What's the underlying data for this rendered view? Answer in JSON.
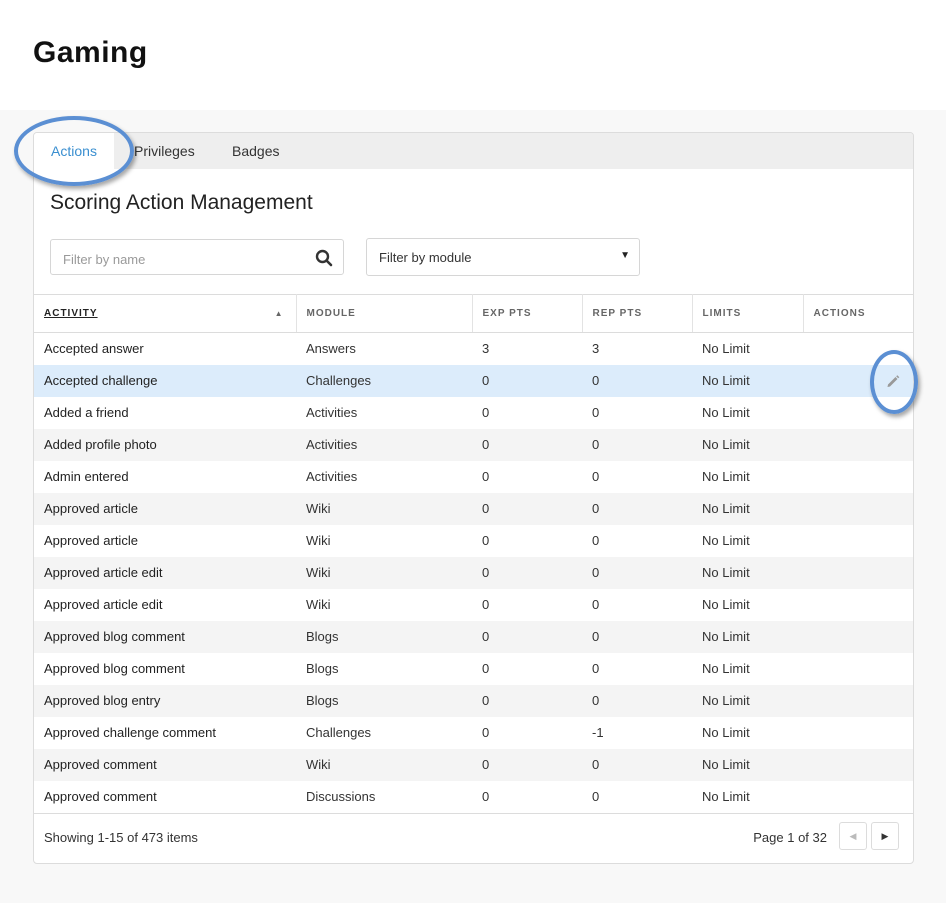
{
  "page": {
    "title": "Gaming"
  },
  "tabs": [
    {
      "label": "Actions",
      "active": true
    },
    {
      "label": "Privileges",
      "active": false
    },
    {
      "label": "Badges",
      "active": false
    }
  ],
  "section": {
    "title": "Scoring Action Management"
  },
  "filters": {
    "name_placeholder": "Filter by name",
    "name_value": "",
    "module_selected": "Filter by module"
  },
  "table": {
    "columns": [
      "ACTIVITY",
      "MODULE",
      "EXP PTS",
      "REP PTS",
      "LIMITS",
      "ACTIONS"
    ],
    "sorted_column": "ACTIVITY",
    "sort_direction": "ascending",
    "rows": [
      {
        "activity": "Accepted answer",
        "module": "Answers",
        "exp": "3",
        "rep": "3",
        "limits": "No Limit"
      },
      {
        "activity": "Accepted challenge",
        "module": "Challenges",
        "exp": "0",
        "rep": "0",
        "limits": "No Limit",
        "highlighted": true,
        "action_icon": "pencil-icon"
      },
      {
        "activity": "Added a friend",
        "module": "Activities",
        "exp": "0",
        "rep": "0",
        "limits": "No Limit"
      },
      {
        "activity": "Added profile photo",
        "module": "Activities",
        "exp": "0",
        "rep": "0",
        "limits": "No Limit"
      },
      {
        "activity": "Admin entered",
        "module": "Activities",
        "exp": "0",
        "rep": "0",
        "limits": "No Limit"
      },
      {
        "activity": "Approved article",
        "module": "Wiki",
        "exp": "0",
        "rep": "0",
        "limits": "No Limit"
      },
      {
        "activity": "Approved article",
        "module": "Wiki",
        "exp": "0",
        "rep": "0",
        "limits": "No Limit"
      },
      {
        "activity": "Approved article edit",
        "module": "Wiki",
        "exp": "0",
        "rep": "0",
        "limits": "No Limit"
      },
      {
        "activity": "Approved article edit",
        "module": "Wiki",
        "exp": "0",
        "rep": "0",
        "limits": "No Limit"
      },
      {
        "activity": "Approved blog comment",
        "module": "Blogs",
        "exp": "0",
        "rep": "0",
        "limits": "No Limit"
      },
      {
        "activity": "Approved blog comment",
        "module": "Blogs",
        "exp": "0",
        "rep": "0",
        "limits": "No Limit"
      },
      {
        "activity": "Approved blog entry",
        "module": "Blogs",
        "exp": "0",
        "rep": "0",
        "limits": "No Limit"
      },
      {
        "activity": "Approved challenge comment",
        "module": "Challenges",
        "exp": "0",
        "rep": "-1",
        "limits": "No Limit"
      },
      {
        "activity": "Approved comment",
        "module": "Wiki",
        "exp": "0",
        "rep": "0",
        "limits": "No Limit"
      },
      {
        "activity": "Approved comment",
        "module": "Discussions",
        "exp": "0",
        "rep": "0",
        "limits": "No Limit"
      }
    ]
  },
  "footer": {
    "showing": "Showing 1-15 of 473 items",
    "page_label": "Page 1 of 32",
    "prev_icon": "chevron-left-icon",
    "next_icon": "chevron-right-icon"
  },
  "colors": {
    "accent": "#3a8fd0",
    "highlight_row": "#dcecfb",
    "annotation": "#5b8fd3"
  }
}
